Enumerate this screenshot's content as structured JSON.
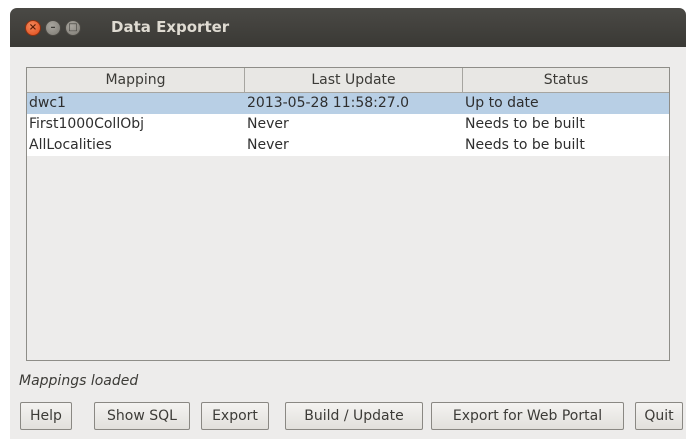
{
  "window": {
    "title": "Data Exporter"
  },
  "table": {
    "columns": [
      "Mapping",
      "Last Update",
      "Status"
    ],
    "rows": [
      {
        "mapping": "dwc1",
        "last_update": "2013-05-28 11:58:27.0",
        "status": "Up to date",
        "selected": true
      },
      {
        "mapping": "First1000CollObj",
        "last_update": "Never",
        "status": "Needs to be built",
        "selected": false
      },
      {
        "mapping": "AllLocalities",
        "last_update": "Never",
        "status": "Needs to be built",
        "selected": false
      }
    ]
  },
  "status_message": "Mappings loaded",
  "buttons": {
    "help": "Help",
    "show_sql": "Show SQL",
    "export": "Export",
    "build_update": "Build / Update",
    "export_web_portal": "Export for Web Portal",
    "quit": "Quit"
  },
  "colors": {
    "titlebar": "#3c3b37",
    "selection": "#b8cfe5",
    "close_button": "#e95420"
  }
}
